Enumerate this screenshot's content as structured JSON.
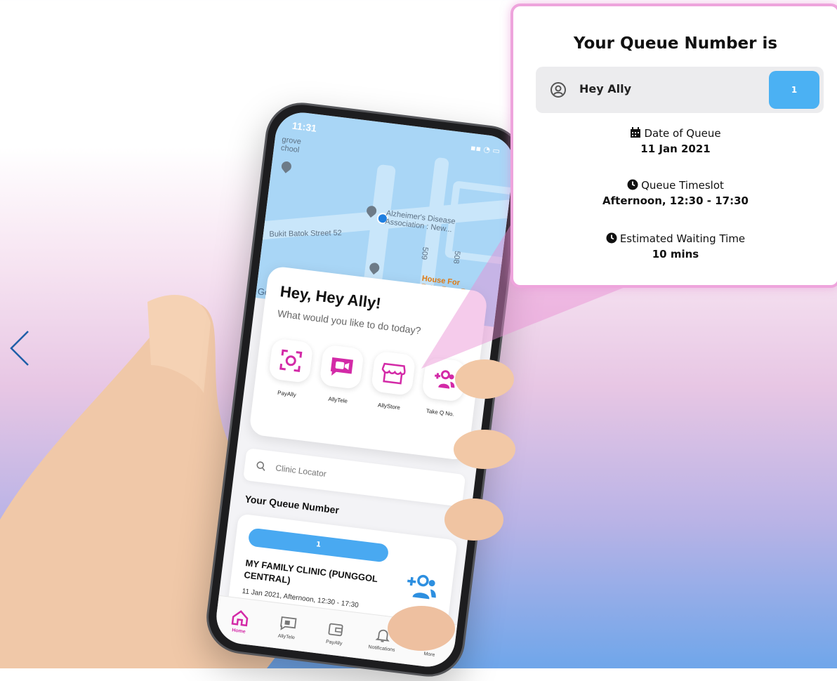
{
  "phone": {
    "status_time": "11:31",
    "map_labels": {
      "school": "grove\nchool",
      "street": "Bukit Batok Street 52",
      "poi1": "Alzheimer's Disease\nAssociation : New...",
      "road_509": "509",
      "road_508": "508",
      "poi2": "House For\nFatty Bom Bom",
      "google": "Go"
    },
    "greeting": "Hey, Hey Ally!",
    "subtitle": "What would you like to do today?",
    "actions": [
      {
        "label": "PayAlly",
        "icon": "scan-icon"
      },
      {
        "label": "AllyTele",
        "icon": "video-chat-icon"
      },
      {
        "label": "AllyStore",
        "icon": "store-icon"
      },
      {
        "label": "Take Q No.",
        "icon": "add-group-icon"
      }
    ],
    "search": {
      "placeholder": "Clinic Locator"
    },
    "queue_heading": "Your Queue Number",
    "queue": {
      "number": "1",
      "clinic": "MY FAMILY CLINIC (PUNGGOL CENTRAL)",
      "datetime": "11 Jan 2021, Afternoon, 12:30 - 17:30"
    },
    "tabs": [
      {
        "label": "Home",
        "icon": "home-icon",
        "active": true
      },
      {
        "label": "AllyTele",
        "icon": "video-chat-icon"
      },
      {
        "label": "PayAlly",
        "icon": "wallet-icon"
      },
      {
        "label": "Notifications",
        "icon": "bell-icon"
      },
      {
        "label": "More",
        "icon": "more-icon"
      }
    ]
  },
  "callout": {
    "title": "Your Queue Number is",
    "name": "Hey Ally",
    "number": "1",
    "date_label": "Date of Queue",
    "date_value": "11 Jan 2021",
    "timeslot_label": "Queue Timeslot",
    "timeslot_value": "Afternoon, 12:30 - 17:30",
    "wait_label": "Estimated Waiting Time",
    "wait_value": "10 mins"
  },
  "colors": {
    "accent": "#d32aa7",
    "blue": "#49a9f1",
    "callout_border": "#eea4dc"
  }
}
